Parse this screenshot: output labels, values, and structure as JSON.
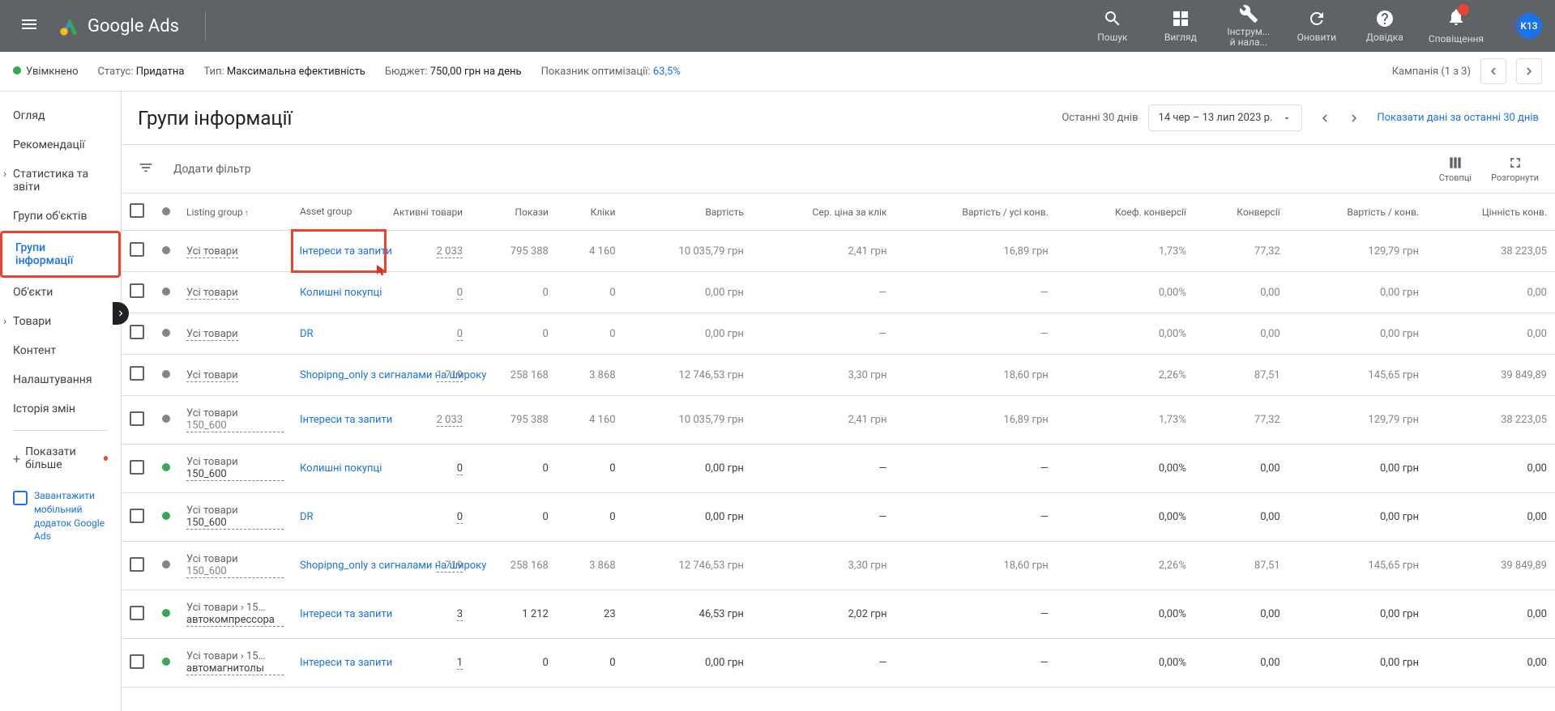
{
  "header": {
    "brand": "Google Ads",
    "tools": {
      "search": "Пошук",
      "view": "Вигляд",
      "tools": "Інструм...\nй нала...",
      "refresh": "Оновити",
      "help": "Довідка",
      "notifications": "Сповіщення"
    },
    "avatar": "K13"
  },
  "subheader": {
    "enabled": "Увімкнено",
    "status_label": "Статус:",
    "status_value": "Придатна",
    "type_label": "Тип:",
    "type_value": "Максимальна ефективність",
    "budget_label": "Бюджет:",
    "budget_value": "750,00 грн на день",
    "opt_label": "Показник оптимізації:",
    "opt_value": "63,5%",
    "campaign_nav": "Кампанія (1 з 3)"
  },
  "sidebar": {
    "items": {
      "overview": "Огляд",
      "recommendations": "Рекомендації",
      "stats": "Статистика та звіти",
      "asset_groups": "Групи об'єктів",
      "listing_groups": "Групи інформації",
      "assets": "Об'єкти",
      "products": "Товари",
      "content": "Контент",
      "settings": "Налаштування",
      "history": "Історія змін",
      "show_more": "Показати більше"
    },
    "mobile_promo": "Завантажити мобільний додаток Google Ads"
  },
  "page": {
    "title": "Групи інформації",
    "date_label": "Останні 30 днів",
    "date_range": "14 чер – 13 лип 2023 р.",
    "date_link": "Показати дані за останні 30 днів"
  },
  "filter_bar": {
    "add_filter": "Додати фільтр",
    "columns": "Стовпці",
    "expand": "Розгорнути"
  },
  "columns": {
    "listing": "Listing group",
    "asset": "Asset group",
    "active": "Активні товари",
    "impressions": "Покази",
    "clicks": "Кліки",
    "cost": "Вартість",
    "cpc": "Сер. ціна за клік",
    "cost_conv": "Вартість / усі конв.",
    "conv_rate": "Коеф. конверсії",
    "conversions": "Конверсії",
    "cost_per_conv": "Вартість / конв.",
    "conv_value": "Цінність конв."
  },
  "rows": [
    {
      "gray": true,
      "status": "gray",
      "listing": "Усі товари",
      "listing_sub": "",
      "asset": "Інтереси та запити",
      "active": "2 033",
      "impressions": "795 388",
      "clicks": "4 160",
      "cost": "10 035,79 грн",
      "cpc": "2,41 грн",
      "cost_conv": "16,89 грн",
      "conv_rate": "1,73%",
      "conversions": "77,32",
      "cost_per_conv": "129,79 грн",
      "conv_value": "38 223,05",
      "highlight": true
    },
    {
      "gray": true,
      "status": "gray",
      "listing": "Усі товари",
      "listing_sub": "",
      "asset": "Колишні покупці",
      "active": "0",
      "impressions": "0",
      "clicks": "0",
      "cost": "0,00 грн",
      "cpc": "—",
      "cost_conv": "—",
      "conv_rate": "0,00%",
      "conversions": "0,00",
      "cost_per_conv": "0,00 грн",
      "conv_value": "0,00"
    },
    {
      "gray": true,
      "status": "gray",
      "listing": "Усі товари",
      "listing_sub": "",
      "asset": "DR",
      "active": "0",
      "impressions": "0",
      "clicks": "0",
      "cost": "0,00 грн",
      "cpc": "—",
      "cost_conv": "—",
      "conv_rate": "0,00%",
      "conversions": "0,00",
      "cost_per_conv": "0,00 грн",
      "conv_value": "0,00"
    },
    {
      "gray": true,
      "status": "gray",
      "listing": "Усі товари",
      "listing_sub": "",
      "asset": "Shopipng_only з сигналами на широку",
      "active": "1 719",
      "impressions": "258 168",
      "clicks": "3 868",
      "cost": "12 746,53 грн",
      "cpc": "3,30 грн",
      "cost_conv": "18,60 грн",
      "conv_rate": "2,26%",
      "conversions": "87,51",
      "cost_per_conv": "145,65 грн",
      "conv_value": "39 849,89"
    },
    {
      "gray": true,
      "status": "gray",
      "listing": "Усі товари",
      "listing_sub": "150_600",
      "asset": "Інтереси та запити",
      "active": "2 033",
      "impressions": "795 388",
      "clicks": "4 160",
      "cost": "10 035,79 грн",
      "cpc": "2,41 грн",
      "cost_conv": "16,89 грн",
      "conv_rate": "1,73%",
      "conversions": "77,32",
      "cost_per_conv": "129,79 грн",
      "conv_value": "38 223,05"
    },
    {
      "gray": false,
      "status": "green",
      "listing": "Усі товари",
      "listing_sub": "150_600",
      "asset": "Колишні покупці",
      "active": "0",
      "impressions": "0",
      "clicks": "0",
      "cost": "0,00 грн",
      "cpc": "—",
      "cost_conv": "—",
      "conv_rate": "0,00%",
      "conversions": "0,00",
      "cost_per_conv": "0,00 грн",
      "conv_value": "0,00"
    },
    {
      "gray": false,
      "status": "green",
      "listing": "Усі товари",
      "listing_sub": "150_600",
      "asset": "DR",
      "active": "0",
      "impressions": "0",
      "clicks": "0",
      "cost": "0,00 грн",
      "cpc": "—",
      "cost_conv": "—",
      "conv_rate": "0,00%",
      "conversions": "0,00",
      "cost_per_conv": "0,00 грн",
      "conv_value": "0,00"
    },
    {
      "gray": true,
      "status": "gray",
      "listing": "Усі товари",
      "listing_sub": "150_600",
      "asset": "Shopipng_only з сигналами на широку",
      "active": "1 719",
      "impressions": "258 168",
      "clicks": "3 868",
      "cost": "12 746,53 грн",
      "cpc": "3,30 грн",
      "cost_conv": "18,60 грн",
      "conv_rate": "2,26%",
      "conversions": "87,51",
      "cost_per_conv": "145,65 грн",
      "conv_value": "39 849,89"
    },
    {
      "gray": false,
      "status": "green",
      "listing": "Усі товари › 15…",
      "listing_sub": "автокомпрессора",
      "asset": "Інтереси та запити",
      "active": "3",
      "impressions": "1 212",
      "clicks": "23",
      "cost": "46,53 грн",
      "cpc": "2,02 грн",
      "cost_conv": "—",
      "conv_rate": "0,00%",
      "conversions": "0,00",
      "cost_per_conv": "0,00 грн",
      "conv_value": "0,00"
    },
    {
      "gray": false,
      "status": "green",
      "listing": "Усі товари › 15…",
      "listing_sub": "автомагнитолы",
      "asset": "Інтереси та запити",
      "active": "1",
      "impressions": "0",
      "clicks": "0",
      "cost": "0,00 грн",
      "cpc": "—",
      "cost_conv": "—",
      "conv_rate": "0,00%",
      "conversions": "0,00",
      "cost_per_conv": "0,00 грн",
      "conv_value": "0,00"
    }
  ]
}
